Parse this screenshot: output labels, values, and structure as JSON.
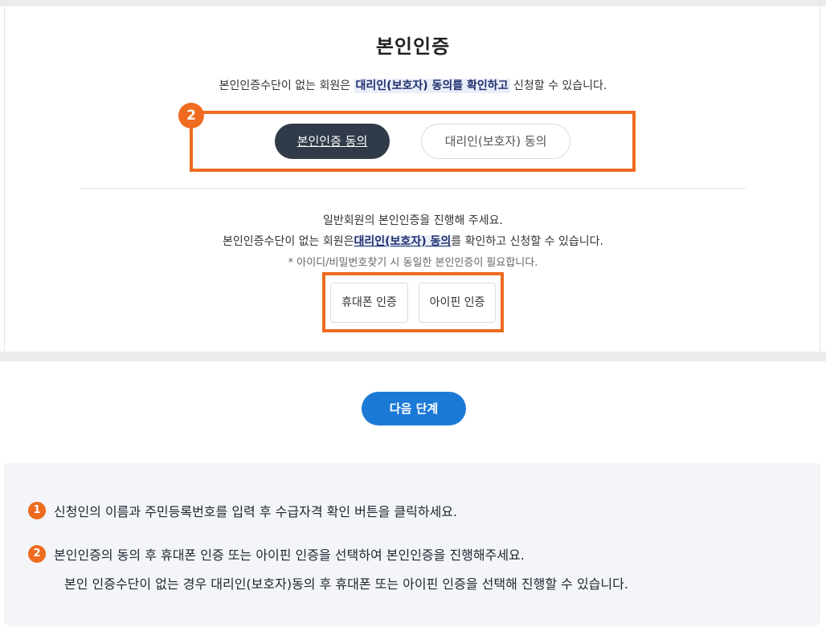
{
  "page": {
    "title": "본인인증",
    "subline_prefix": "본인인증수단이 없는 회원은 ",
    "subline_highlight": "대리인(보호자) 동의를 확인하고",
    "subline_suffix": " 신청할 수 있습니다."
  },
  "step_badge": "2",
  "tabs": {
    "self": "본인인증 동의",
    "proxy": "대리인(보호자) 동의"
  },
  "info": {
    "line1": "일반회원의 본인인증을 진행해 주세요.",
    "line2_prefix": "본인인증수단이 없는 회원은",
    "line2_highlight": "대리인(보호자) 동의",
    "line2_suffix": "를 확인하고 신청할 수 있습니다.",
    "line3": "* 아이디/비밀번호찾기 시 동일한 본인인증이 필요합니다."
  },
  "auth": {
    "phone": "휴대폰 인증",
    "ipin": "아이핀 인증"
  },
  "next_button": "다음 단계",
  "notes": {
    "n1_badge": "1",
    "n1": "신청인의 이름과 주민등록번호를 입력 후 수급자격 확인 버튼을 클릭하세요.",
    "n2_badge": "2",
    "n2": "본인인증의 동의 후 휴대폰 인증 또는 아이핀 인증을 선택하여 본인인증을 진행해주세요.",
    "n2b": "본인 인증수단이 없는 경우 대리인(보호자)동의 후 휴대폰 또는 아이핀 인증을 선택해 진행할 수 있습니다."
  },
  "colors": {
    "accent_orange": "#ee6b1f",
    "primary_blue": "#1c7ad7",
    "active_tab": "#313a48"
  }
}
